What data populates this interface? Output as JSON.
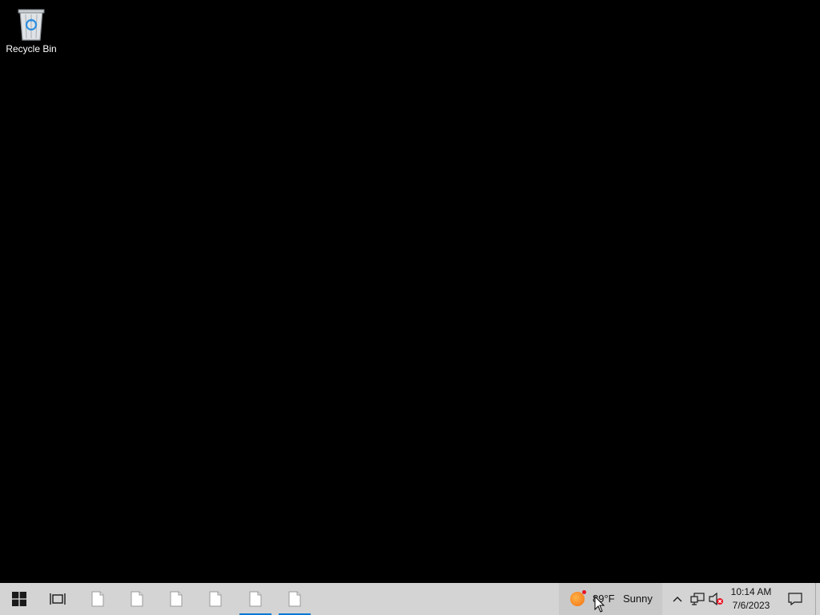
{
  "desktop": {
    "icons": [
      {
        "label": "Recycle Bin",
        "icon": "recycle-bin-icon"
      }
    ]
  },
  "taskbar": {
    "start_icon": "windows-logo-icon",
    "task_view_icon": "task-view-icon",
    "apps": [
      {
        "icon": "document-icon",
        "active": false
      },
      {
        "icon": "document-icon",
        "active": false
      },
      {
        "icon": "document-icon",
        "active": false
      },
      {
        "icon": "document-icon",
        "active": false
      },
      {
        "icon": "document-icon",
        "active": true
      },
      {
        "icon": "document-icon",
        "active": true
      }
    ],
    "weather": {
      "temperature": "89°F",
      "condition": "Sunny",
      "icon": "sun-icon"
    },
    "tray": {
      "overflow_icon": "chevron-up-icon",
      "network_icon": "network-icon",
      "volume_icon": "volume-muted-icon"
    },
    "clock": {
      "time": "10:14 AM",
      "date": "7/6/2023"
    },
    "notification_icon": "action-center-icon",
    "accent_color": "#0078d7"
  }
}
